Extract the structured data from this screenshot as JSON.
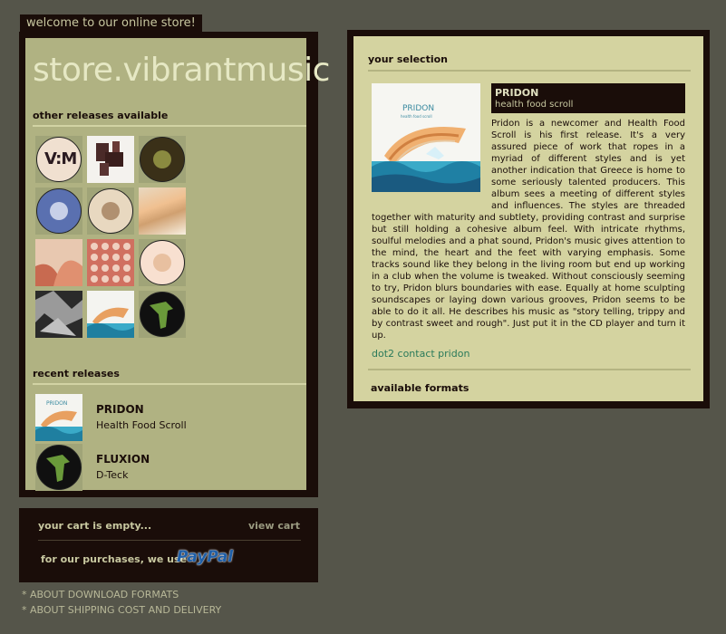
{
  "header": {
    "welcome": "welcome to our online store!"
  },
  "sidebar": {
    "store_title": "store.vibrantmusic",
    "other_releases_heading": "other releases available",
    "recent_releases_heading": "recent releases",
    "recent": [
      {
        "artist": "PRIDON",
        "title": "Health Food Scroll"
      },
      {
        "artist": "FLUXION",
        "title": "D-Teck"
      }
    ]
  },
  "cart": {
    "empty_label": "your cart is empty...",
    "view_cart": "view cart",
    "purchases_label": "for our purchases, we use",
    "paypal_label": "PayPal"
  },
  "footer": {
    "links": [
      "* ABOUT DOWNLOAD FORMATS",
      "* ABOUT SHIPPING COST AND DELIVERY"
    ]
  },
  "selection": {
    "heading": "your selection",
    "artist": "PRIDON",
    "title": "health food scroll",
    "cover_text": "PRIDON",
    "cover_subtext": "health food scroll",
    "description": "Pridon is a newcomer and Health Food Scroll is his first release. It's a very assured piece of work that ropes in a myriad of different styles and is yet another indication that Greece is home to some seriously talented producers. This album sees a meeting of different styles and influences. The styles are threaded together with maturity and subtlety, providing contrast and surprise but still holding a cohesive album feel. With intricate rhythms, soulful melodies and a phat sound, Pridon's music gives attention to the mind, the heart and the feet with varying emphasis. Some tracks sound like they belong in the living room but end up working in a club when the volume is tweaked. Without consciously seeming to try, Pridon blurs boundaries with ease. Equally at home sculpting soundscapes or laying down various grooves, Pridon seems to be able to do it all. He describes his music as \"story telling, trippy and by contrast sweet and rough\". Just put it in the CD player and turn it up.",
    "contact_link": "dot2 contact pridon",
    "formats_heading": "available formats"
  },
  "colors": {
    "background": "#55554a",
    "panel_dark": "#1a0d09",
    "left_panel": "#b0b282",
    "right_panel": "#d4d3a0",
    "link_green": "#2a7a5a"
  }
}
